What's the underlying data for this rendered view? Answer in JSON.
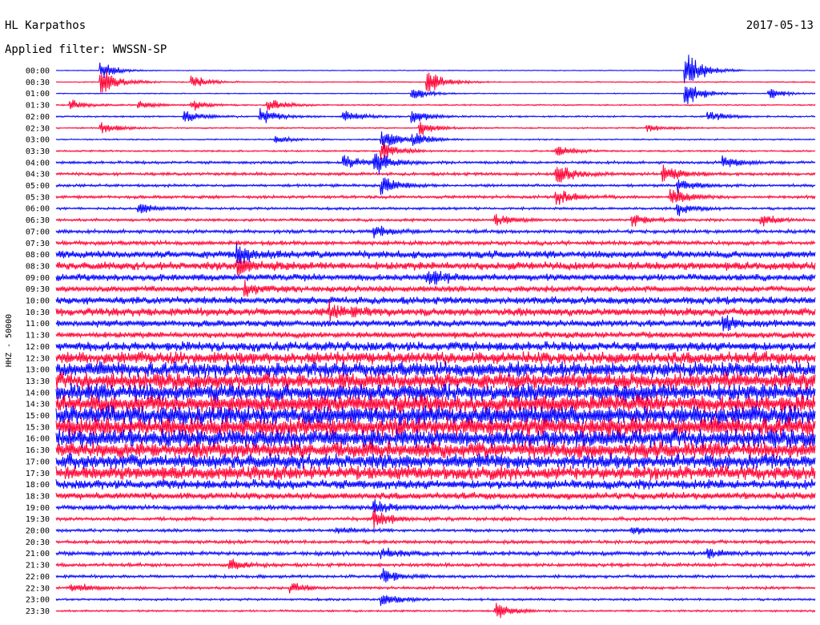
{
  "chart_data": {
    "type": "line",
    "station": "HL Karpathos",
    "date": "2017-05-13",
    "filter_label": "Applied filter: WWSSN-SP",
    "ylabel": "HHZ - 50000",
    "colors": {
      "odd": "#0000ff",
      "even": "#ff0033"
    },
    "rows": [
      {
        "t": "00:00",
        "level": 0.6,
        "events": [
          {
            "pos": 0.06,
            "amp": 12
          },
          {
            "pos": 0.83,
            "amp": 30
          }
        ]
      },
      {
        "t": "00:30",
        "level": 0.8,
        "events": [
          {
            "pos": 0.06,
            "amp": 22
          },
          {
            "pos": 0.18,
            "amp": 10
          },
          {
            "pos": 0.49,
            "amp": 22
          }
        ]
      },
      {
        "t": "01:00",
        "level": 0.7,
        "events": [
          {
            "pos": 0.47,
            "amp": 10
          },
          {
            "pos": 0.83,
            "amp": 20
          },
          {
            "pos": 0.94,
            "amp": 8
          }
        ]
      },
      {
        "t": "01:30",
        "level": 1.0,
        "events": [
          {
            "pos": 0.02,
            "amp": 8
          },
          {
            "pos": 0.11,
            "amp": 6
          },
          {
            "pos": 0.18,
            "amp": 8
          },
          {
            "pos": 0.28,
            "amp": 10
          }
        ]
      },
      {
        "t": "02:00",
        "level": 1.2,
        "events": [
          {
            "pos": 0.17,
            "amp": 10
          },
          {
            "pos": 0.27,
            "amp": 12
          },
          {
            "pos": 0.38,
            "amp": 10
          },
          {
            "pos": 0.47,
            "amp": 10
          },
          {
            "pos": 0.86,
            "amp": 8
          }
        ]
      },
      {
        "t": "02:30",
        "level": 1.0,
        "events": [
          {
            "pos": 0.06,
            "amp": 8
          },
          {
            "pos": 0.48,
            "amp": 10
          },
          {
            "pos": 0.78,
            "amp": 6
          }
        ]
      },
      {
        "t": "03:00",
        "level": 1.0,
        "events": [
          {
            "pos": 0.29,
            "amp": 6
          },
          {
            "pos": 0.43,
            "amp": 18
          },
          {
            "pos": 0.47,
            "amp": 10
          }
        ]
      },
      {
        "t": "03:30",
        "level": 1.2,
        "events": [
          {
            "pos": 0.43,
            "amp": 14
          },
          {
            "pos": 0.66,
            "amp": 10
          }
        ]
      },
      {
        "t": "04:00",
        "level": 2.0,
        "events": [
          {
            "pos": 0.38,
            "amp": 12
          },
          {
            "pos": 0.42,
            "amp": 18
          },
          {
            "pos": 0.88,
            "amp": 10
          }
        ]
      },
      {
        "t": "04:30",
        "level": 2.2,
        "events": [
          {
            "pos": 0.66,
            "amp": 16
          },
          {
            "pos": 0.8,
            "amp": 14
          }
        ]
      },
      {
        "t": "05:00",
        "level": 2.0,
        "events": [
          {
            "pos": 0.43,
            "amp": 16
          },
          {
            "pos": 0.82,
            "amp": 10
          }
        ]
      },
      {
        "t": "05:30",
        "level": 2.2,
        "events": [
          {
            "pos": 0.66,
            "amp": 12
          },
          {
            "pos": 0.81,
            "amp": 14
          }
        ]
      },
      {
        "t": "06:00",
        "level": 1.8,
        "events": [
          {
            "pos": 0.11,
            "amp": 8
          },
          {
            "pos": 0.82,
            "amp": 10
          }
        ]
      },
      {
        "t": "06:30",
        "level": 2.0,
        "events": [
          {
            "pos": 0.58,
            "amp": 8
          },
          {
            "pos": 0.76,
            "amp": 10
          },
          {
            "pos": 0.93,
            "amp": 8
          }
        ]
      },
      {
        "t": "07:00",
        "level": 2.6,
        "events": [
          {
            "pos": 0.42,
            "amp": 10
          }
        ]
      },
      {
        "t": "07:30",
        "level": 3.0,
        "events": []
      },
      {
        "t": "08:00",
        "level": 5.5,
        "events": [
          {
            "pos": 0.24,
            "amp": 14
          }
        ]
      },
      {
        "t": "08:30",
        "level": 6.0,
        "events": [
          {
            "pos": 0.24,
            "amp": 12
          }
        ]
      },
      {
        "t": "09:00",
        "level": 5.0,
        "events": [
          {
            "pos": 0.49,
            "amp": 12
          }
        ]
      },
      {
        "t": "09:30",
        "level": 4.5,
        "events": [
          {
            "pos": 0.25,
            "amp": 10
          }
        ]
      },
      {
        "t": "10:00",
        "level": 5.5,
        "events": []
      },
      {
        "t": "10:30",
        "level": 6.0,
        "events": [
          {
            "pos": 0.36,
            "amp": 10
          }
        ]
      },
      {
        "t": "11:00",
        "level": 5.0,
        "events": [
          {
            "pos": 0.88,
            "amp": 10
          }
        ]
      },
      {
        "t": "11:30",
        "level": 4.5,
        "events": []
      },
      {
        "t": "12:00",
        "level": 7.0,
        "events": []
      },
      {
        "t": "12:30",
        "level": 9.0,
        "events": []
      },
      {
        "t": "13:00",
        "level": 11.0,
        "events": []
      },
      {
        "t": "13:30",
        "level": 12.0,
        "events": []
      },
      {
        "t": "14:00",
        "level": 13.0,
        "events": []
      },
      {
        "t": "14:30",
        "level": 13.0,
        "events": []
      },
      {
        "t": "15:00",
        "level": 14.0,
        "events": []
      },
      {
        "t": "15:30",
        "level": 14.0,
        "events": []
      },
      {
        "t": "16:00",
        "level": 13.0,
        "events": []
      },
      {
        "t": "16:30",
        "level": 12.0,
        "events": []
      },
      {
        "t": "17:00",
        "level": 11.0,
        "events": []
      },
      {
        "t": "17:30",
        "level": 10.0,
        "events": []
      },
      {
        "t": "18:00",
        "level": 7.0,
        "events": []
      },
      {
        "t": "18:30",
        "level": 5.0,
        "events": []
      },
      {
        "t": "19:00",
        "level": 3.5,
        "events": [
          {
            "pos": 0.42,
            "amp": 10
          }
        ]
      },
      {
        "t": "19:30",
        "level": 2.5,
        "events": [
          {
            "pos": 0.42,
            "amp": 14
          }
        ]
      },
      {
        "t": "20:00",
        "level": 2.2,
        "events": [
          {
            "pos": 0.37,
            "amp": 6
          },
          {
            "pos": 0.76,
            "amp": 6
          }
        ]
      },
      {
        "t": "20:30",
        "level": 2.5,
        "events": []
      },
      {
        "t": "21:00",
        "level": 3.0,
        "events": [
          {
            "pos": 0.43,
            "amp": 8
          },
          {
            "pos": 0.86,
            "amp": 6
          }
        ]
      },
      {
        "t": "21:30",
        "level": 2.5,
        "events": [
          {
            "pos": 0.23,
            "amp": 8
          }
        ]
      },
      {
        "t": "22:00",
        "level": 2.2,
        "events": [
          {
            "pos": 0.43,
            "amp": 12
          }
        ]
      },
      {
        "t": "22:30",
        "level": 2.0,
        "events": [
          {
            "pos": 0.02,
            "amp": 8
          },
          {
            "pos": 0.31,
            "amp": 8
          }
        ]
      },
      {
        "t": "23:00",
        "level": 1.6,
        "events": [
          {
            "pos": 0.43,
            "amp": 10
          }
        ]
      },
      {
        "t": "23:30",
        "level": 1.4,
        "events": [
          {
            "pos": 0.58,
            "amp": 12
          }
        ]
      }
    ]
  }
}
